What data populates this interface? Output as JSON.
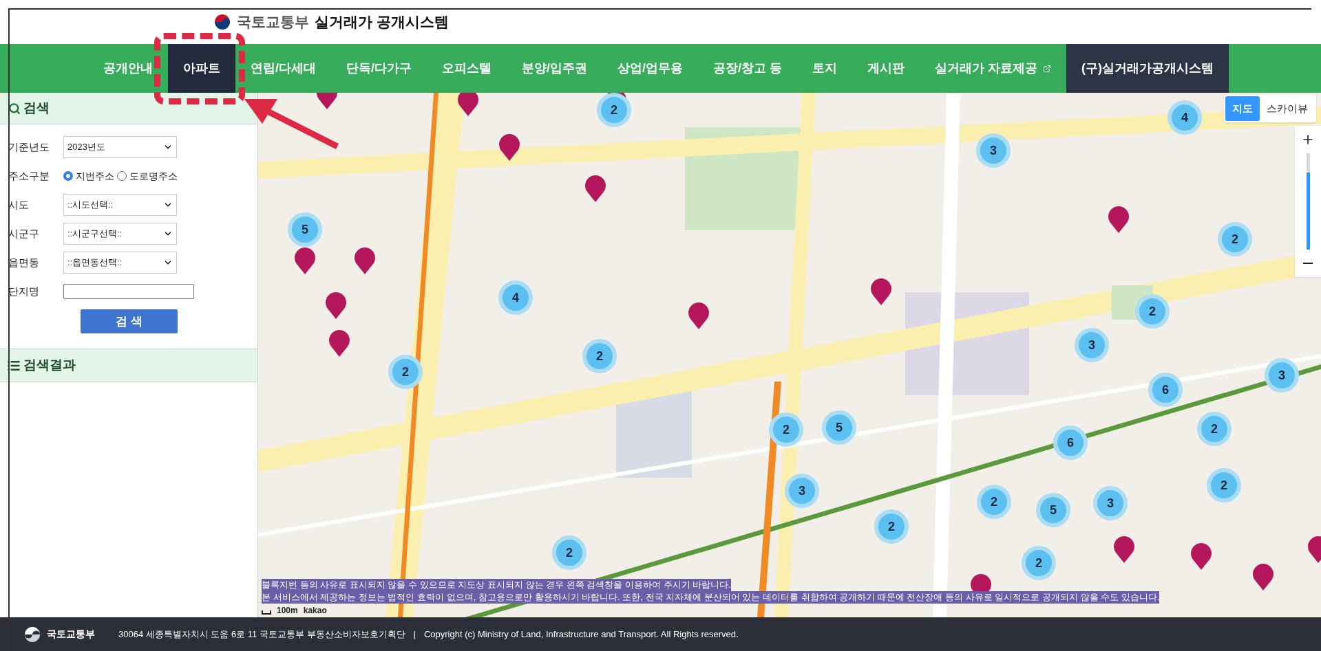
{
  "header": {
    "ministry": "국토교통부",
    "title": "실거래가 공개시스템"
  },
  "nav": [
    {
      "label": "공개안내",
      "selected": false,
      "kind": "tab"
    },
    {
      "label": "아파트",
      "selected": true,
      "kind": "tab"
    },
    {
      "label": "연립/다세대",
      "selected": false,
      "kind": "tab"
    },
    {
      "label": "단독/다가구",
      "selected": false,
      "kind": "tab"
    },
    {
      "label": "오피스텔",
      "selected": false,
      "kind": "tab"
    },
    {
      "label": "분양/입주권",
      "selected": false,
      "kind": "tab"
    },
    {
      "label": "상업/업무용",
      "selected": false,
      "kind": "tab"
    },
    {
      "label": "공장/창고 등",
      "selected": false,
      "kind": "tab"
    },
    {
      "label": "토지",
      "selected": false,
      "kind": "tab"
    },
    {
      "label": "게시판",
      "selected": false,
      "kind": "tab"
    },
    {
      "label": "실거래가 자료제공",
      "selected": false,
      "kind": "external"
    },
    {
      "label": "(구)실거래가공개시스템",
      "selected": false,
      "kind": "legacy"
    }
  ],
  "search_panel": {
    "title": "검색",
    "fields": [
      {
        "kind": "select",
        "label": "기준년도",
        "value": "2023년도"
      },
      {
        "kind": "radio",
        "label": "주소구분",
        "options": [
          {
            "label": "지번주소",
            "selected": true
          },
          {
            "label": "도로명주소",
            "selected": false
          }
        ]
      },
      {
        "kind": "select",
        "label": "시도",
        "value": "::시도선택::"
      },
      {
        "kind": "select",
        "label": "시군구",
        "value": "::시군구선택::"
      },
      {
        "kind": "select",
        "label": "읍면동",
        "value": "::읍면동선택::"
      },
      {
        "kind": "text",
        "label": "단지명"
      }
    ],
    "button": "검 색"
  },
  "results_panel": {
    "title": "검색결과"
  },
  "map": {
    "view_toggle": [
      {
        "label": "지도",
        "selected": true
      },
      {
        "label": "스카이뷰",
        "selected": false
      }
    ],
    "zoom": {
      "level": 0.8
    },
    "clusters": [
      {
        "count": "2"
      },
      {
        "count": "4"
      },
      {
        "count": "3"
      },
      {
        "count": "5"
      },
      {
        "count": "2"
      },
      {
        "count": "4"
      },
      {
        "count": "2"
      },
      {
        "count": "3"
      },
      {
        "count": "2"
      },
      {
        "count": "2"
      },
      {
        "count": "3"
      },
      {
        "count": "6"
      },
      {
        "count": "2"
      },
      {
        "count": "5"
      },
      {
        "count": "2"
      },
      {
        "count": "6"
      },
      {
        "count": "2"
      },
      {
        "count": "3"
      },
      {
        "count": "2"
      },
      {
        "count": "5"
      },
      {
        "count": "3"
      },
      {
        "count": "2"
      },
      {
        "count": "2"
      },
      {
        "count": "2"
      }
    ],
    "scale": {
      "distance": "100m",
      "provider": "kakao"
    },
    "notices": [
      "블록지번 등의 사유로 표시되지 않을 수 있으므로 지도상 표시되지 않는 경우 왼쪽 검색창을 이용하여 주시기 바랍니다.",
      "본 서비스에서 제공하는 정보는 법적인 효력이 없으며, 참고용으로만 활용하시기 바랍니다. 또한, 전국 지자체에 분산되어 있는 데이터를 취합하여 공개하기 때문에 전산장애 등의 사유로 일시적으로 공개되지 않을 수도 있습니다."
    ]
  },
  "footer": {
    "ministry": "국토교통부",
    "address": "30064 세종특별자치시 도움 6로 11 국토교통부 부동산소비자보호기획단",
    "separator": "|",
    "copyright": "Copyright (c) Ministry of Land, Infrastructure and Transport. All Rights reserved."
  }
}
